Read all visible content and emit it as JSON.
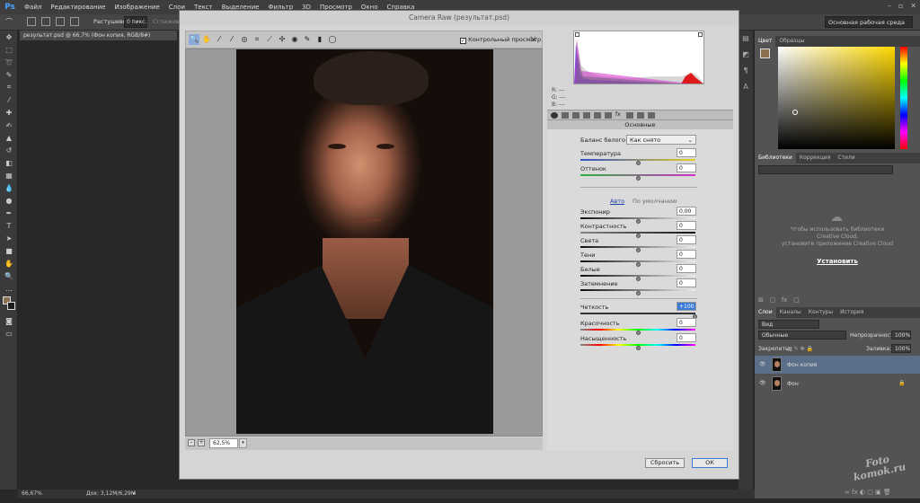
{
  "app": {
    "logo": "Ps",
    "menu": [
      "Файл",
      "Редактирование",
      "Изображение",
      "Слои",
      "Текст",
      "Выделение",
      "Фильтр",
      "3D",
      "Просмотр",
      "Окно",
      "Справка"
    ],
    "window_controls": [
      "–",
      "▫",
      "✕"
    ]
  },
  "options_bar": {
    "feather_label": "Растушевка:",
    "feather_value": "0 пикс.",
    "smooth_label": "Сглаживание",
    "workspace": "Основная рабочая среда"
  },
  "document": {
    "tab_title": "результат.psd @ 66,7% (Фон копия, RGB/8#)",
    "status_zoom": "66,67%",
    "status_doc": "Док: 3,12M/6,29M"
  },
  "camera_raw": {
    "title": "Camera Raw (результат.psd)",
    "preview_label": "Контрольный просмотр",
    "zoom_value": "62,5%",
    "zoom_minus": "–",
    "zoom_plus": "+",
    "rgb_readout": {
      "r": "R:  ---",
      "g": "G:  ---",
      "b": "B:  ---"
    },
    "section_title": "Основные",
    "white_balance_label": "Баланс белого:",
    "white_balance_value": "Как снято",
    "temperature": {
      "label": "Температура",
      "value": "0"
    },
    "tint": {
      "label": "Оттенок",
      "value": "0"
    },
    "auto_link": "Авто",
    "default_link": "По умолчанию",
    "exposure": {
      "label": "Экспонир",
      "value": "0,00"
    },
    "contrast": {
      "label": "Контрастность",
      "value": "0"
    },
    "highlights": {
      "label": "Света",
      "value": "0"
    },
    "shadows": {
      "label": "Тени",
      "value": "0"
    },
    "whites": {
      "label": "Белые",
      "value": "0"
    },
    "blacks": {
      "label": "Затемнение",
      "value": "0"
    },
    "clarity": {
      "label": "Четкость",
      "value": "+100"
    },
    "vibrance": {
      "label": "Красочность",
      "value": "0"
    },
    "saturation": {
      "label": "Насыщенность",
      "value": "0"
    },
    "reset_button": "Сбросить",
    "ok_button": "ОК"
  },
  "panels": {
    "color_tabs": [
      "Цвет",
      "Образцы"
    ],
    "library_tabs": [
      "Библиотеки",
      "Коррекция",
      "Стили"
    ],
    "cc_message_1": "Чтобы использовать библиотеки",
    "cc_message_2": "Creative Cloud,",
    "cc_message_3": "установите приложение Creative Cloud",
    "install_link": "Установить",
    "layers_tabs": [
      "Слои",
      "Каналы",
      "Контуры",
      "История"
    ],
    "kind_filter": "Вид",
    "blend_mode": "Обычные",
    "opacity_label": "Непрозрачность:",
    "opacity_value": "100%",
    "lock_label": "Закрепить:",
    "fill_label": "Заливка:",
    "fill_value": "100%",
    "layers": [
      {
        "name": "Фон копия",
        "selected": true
      },
      {
        "name": "Фон",
        "selected": false
      }
    ]
  },
  "watermark": {
    "line1": "Foto",
    "line2": "komok.ru"
  },
  "colors": {
    "accent": "#3a7ad8",
    "selected_layer": "#5b7088"
  }
}
